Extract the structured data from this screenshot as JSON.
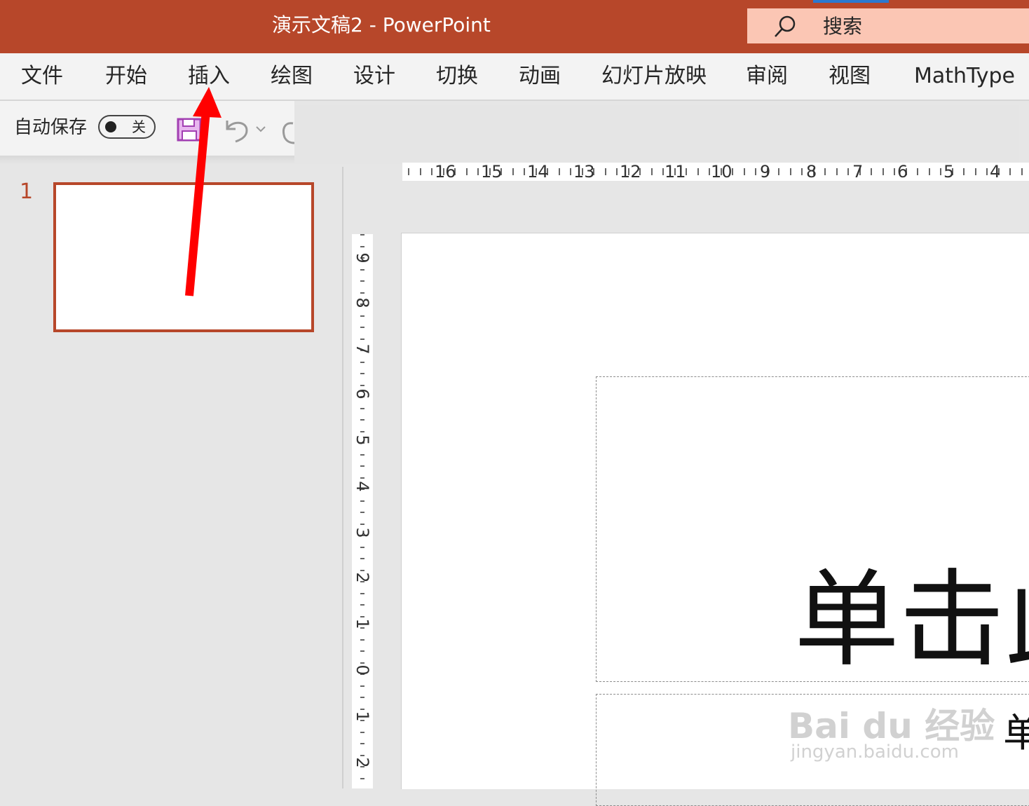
{
  "window": {
    "title": "演示文稿2  -  PowerPoint",
    "search_label": "搜索"
  },
  "ribbon": {
    "tabs": [
      {
        "label": "文件"
      },
      {
        "label": "开始"
      },
      {
        "label": "插入"
      },
      {
        "label": "绘图"
      },
      {
        "label": "设计"
      },
      {
        "label": "切换"
      },
      {
        "label": "动画"
      },
      {
        "label": "幻灯片放映"
      },
      {
        "label": "审阅"
      },
      {
        "label": "视图"
      },
      {
        "label": "MathType"
      }
    ]
  },
  "quick_access": {
    "autosave_label": "自动保存",
    "autosave_state": "关"
  },
  "thumbnails": {
    "slide_number": "1"
  },
  "rulers": {
    "horizontal": [
      "16",
      "15",
      "14",
      "13",
      "12",
      "11",
      "10",
      "9",
      "8",
      "7",
      "6",
      "5",
      "4"
    ],
    "vertical": [
      "9",
      "8",
      "7",
      "6",
      "5",
      "4",
      "3",
      "2",
      "1",
      "0",
      "1",
      "2"
    ]
  },
  "slide": {
    "title_placeholder": "单击此",
    "subtitle_placeholder": "单"
  },
  "watermark": {
    "main": "Bai du 经验",
    "sub": "jingyan.baidu.com"
  },
  "colors": {
    "accent": "#b7472a",
    "search_bg": "#fbc6b4",
    "annotation_arrow": "#ff0000",
    "save_icon": "#a23fb2"
  }
}
